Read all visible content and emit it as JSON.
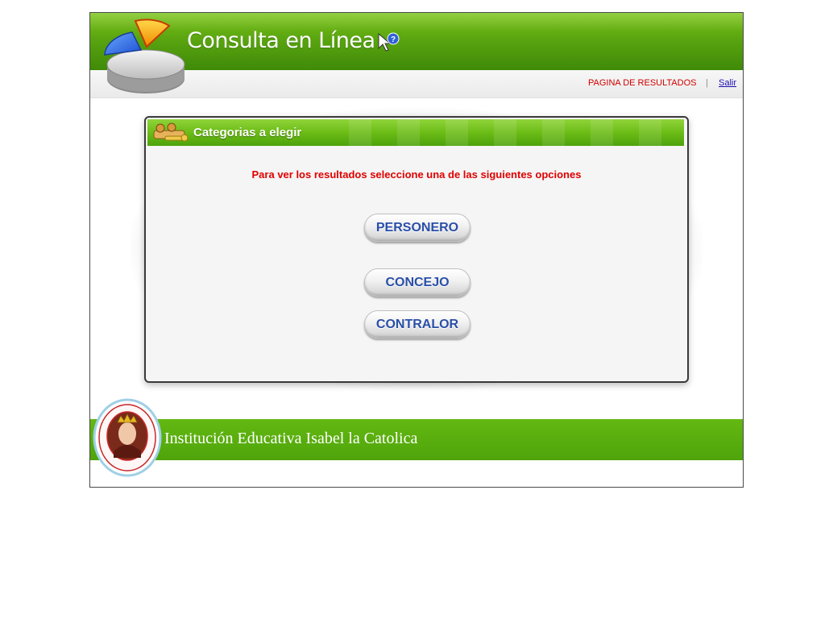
{
  "header": {
    "title": "Consulta en Línea",
    "help_icon": "help-cursor-icon",
    "logo_icon": "pie-chart-logo-icon"
  },
  "nav": {
    "results_label": "PAGINA DE RESULTADOS",
    "separator": "|",
    "exit_label": "Salir"
  },
  "panel": {
    "title": "Categorias a elegir",
    "icon": "users-key-icon",
    "instruction": "Para ver los resultados seleccione una de las siguientes opciones",
    "options": [
      "PERSONERO",
      "CONCEJO",
      "CONTRALOR"
    ]
  },
  "footer": {
    "institution": "Institución Educativa Isabel la Catolica",
    "seal_icon": "school-seal-icon"
  },
  "colors": {
    "brand_green": "#5aa510",
    "instruction_red": "#e00000",
    "button_text_blue": "#2a4fa8",
    "link_blue": "#1a0db0"
  }
}
